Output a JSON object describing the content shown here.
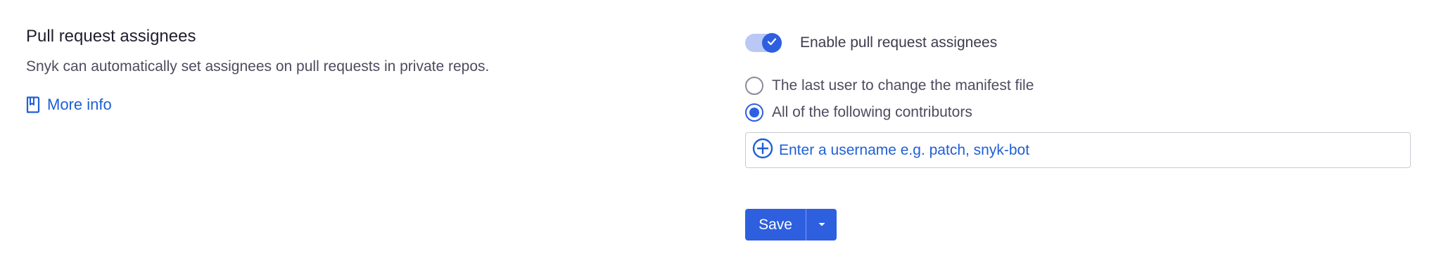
{
  "section": {
    "title": "Pull request assignees",
    "description": "Snyk can automatically set assignees on pull requests in private repos.",
    "more_info_label": "More info"
  },
  "settings": {
    "toggle": {
      "label": "Enable pull request assignees",
      "enabled": true
    },
    "radio_options": [
      {
        "label": "The last user to change the manifest file",
        "selected": false
      },
      {
        "label": "All of the following contributors",
        "selected": true
      }
    ],
    "username_input": {
      "placeholder": "Enter a username e.g. patch, snyk-bot"
    },
    "save_label": "Save"
  },
  "icons": {
    "more_info": "book-icon",
    "toggle_check": "check-icon",
    "add_user": "plus-circle-icon",
    "dropdown": "caret-down-icon"
  },
  "colors": {
    "accent": "#2d5fdf",
    "link": "#1f5fd6",
    "toggle_track": "#b9c8f5"
  }
}
